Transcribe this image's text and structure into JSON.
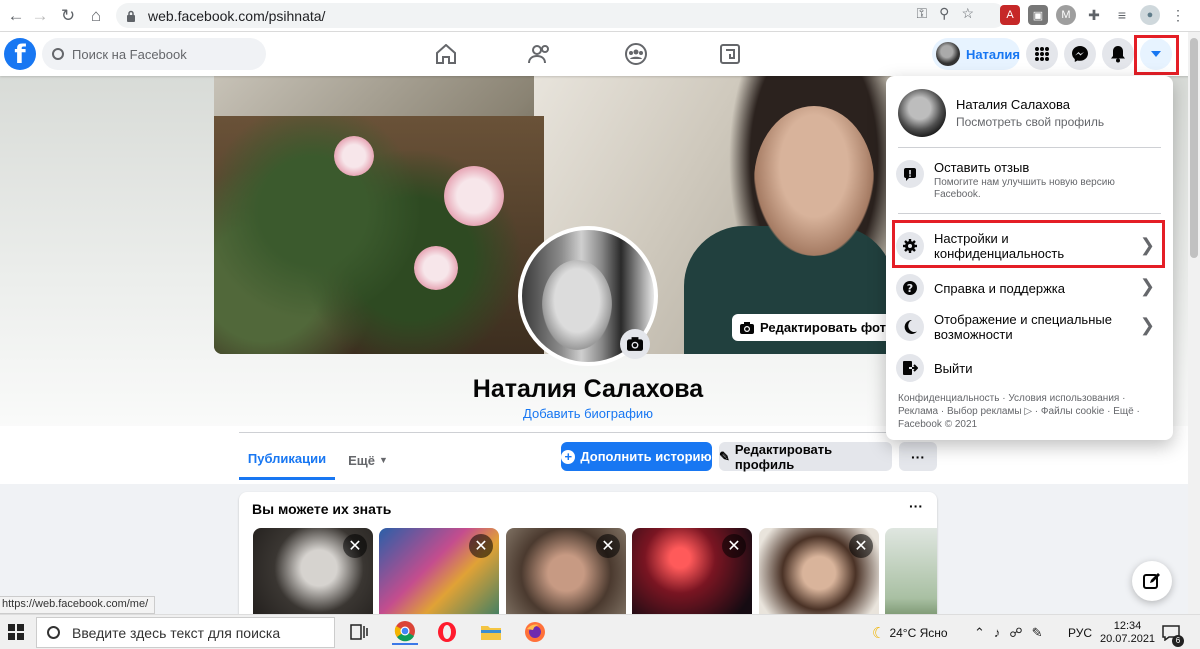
{
  "browser": {
    "url": "web.facebook.com/psihnata/",
    "status_url": "https://web.facebook.com/me/"
  },
  "header": {
    "search_placeholder": "Поиск на Facebook",
    "user_chip": "Наталия",
    "logo_letter": "f"
  },
  "profile": {
    "name": "Наталия Салахова",
    "add_bio": "Добавить биографию",
    "edit_cover": "Редактировать фото об"
  },
  "tabs": {
    "publications": "Публикации",
    "more": "Ещё"
  },
  "actions": {
    "add_story": "Дополнить историю",
    "edit_profile": "Редактировать профиль",
    "dots": "···"
  },
  "pymk": {
    "title": "Вы можете их знать",
    "dots": "···"
  },
  "menu": {
    "user_name": "Наталия Салахова",
    "view_profile": "Посмотреть свой профиль",
    "feedback_title": "Оставить отзыв",
    "feedback_sub": "Помогите нам улучшить новую версию Facebook.",
    "settings_line1": "Настройки и",
    "settings_line2": "конфиденциальность",
    "help": "Справка и поддержка",
    "display_line1": "Отображение и специальные",
    "display_line2": "возможности",
    "logout": "Выйти",
    "footer": "Конфиденциальность · Условия использования · Реклама · Выбор рекламы ▷ · Файлы cookie · Ещё · Facebook © 2021"
  },
  "taskbar": {
    "search_placeholder": "Введите здесь текст для поиска",
    "weather": "24°C  Ясно",
    "lang": "РУС",
    "time": "12:34",
    "date": "20.07.2021",
    "notif_count": "6"
  },
  "colors": {
    "fb_blue": "#1877f2",
    "highlight_red": "#e41e26"
  }
}
